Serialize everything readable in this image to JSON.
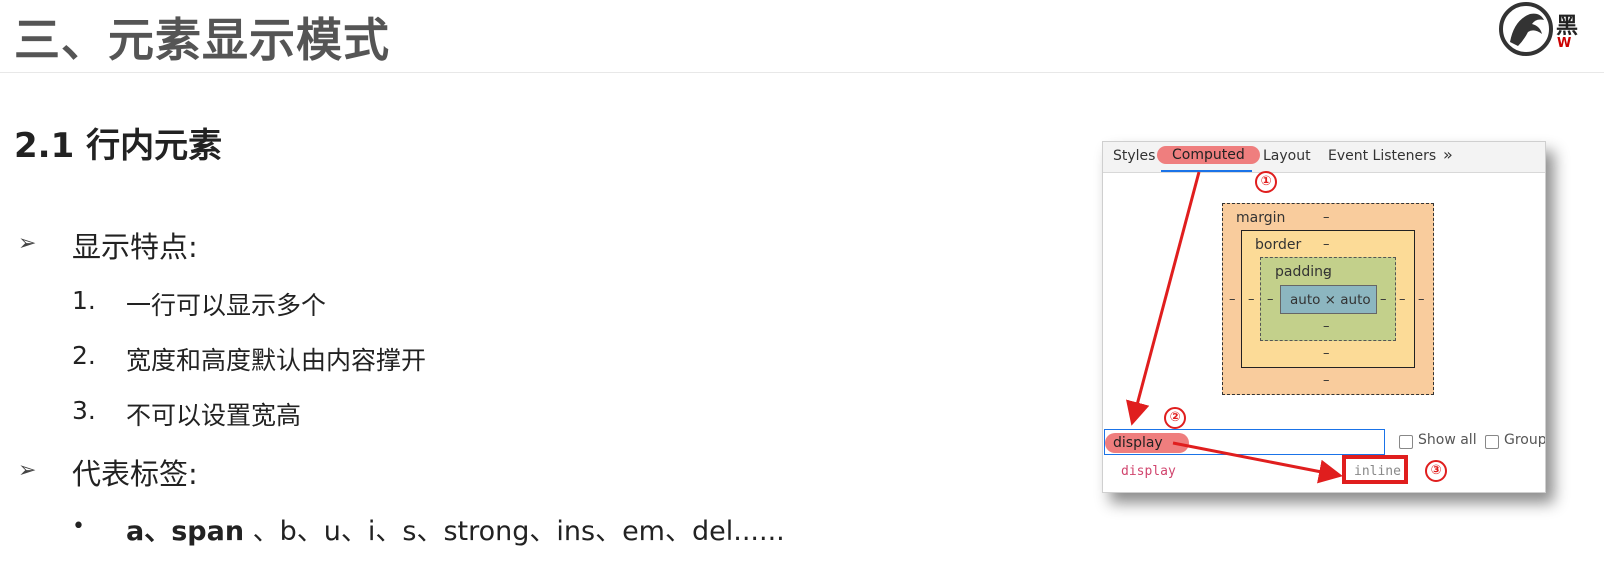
{
  "header": {
    "title": "三、元素显示模式",
    "logo_char": "黑",
    "logo_sub": "W"
  },
  "section": {
    "title": "2.1 行内元素"
  },
  "features": {
    "heading": "显示特点:",
    "items": [
      {
        "num": "1.",
        "text": "一行可以显示多个"
      },
      {
        "num": "2.",
        "text": "宽度和高度默认由内容撑开"
      },
      {
        "num": "3.",
        "text": "不可以设置宽高"
      }
    ]
  },
  "tags": {
    "heading": "代表标签:",
    "bold_text": "a、span",
    "rest_text": " 、b、u、i、s、strong、ins、em、del......"
  },
  "devtools": {
    "tabs": [
      "Styles",
      "Computed",
      "Layout",
      "Event Listeners",
      "»"
    ],
    "active_tab": "Computed",
    "box_model": {
      "margin_label": "margin",
      "border_label": "border",
      "padding_label": "padding",
      "content": "auto × auto",
      "dash": "–"
    },
    "filter": {
      "value": "display",
      "show_all_label": "Show all",
      "group_label": "Group"
    },
    "property": {
      "name": "display",
      "value": "inline"
    },
    "annotations": [
      "①",
      "②",
      "③"
    ],
    "colors": {
      "margin": "#f9cc9d",
      "border": "#fcdb97",
      "padding": "#c3d08b",
      "content": "#8cb6c0",
      "highlight": "#ef7e7e",
      "arrow": "#e01e1e"
    }
  }
}
